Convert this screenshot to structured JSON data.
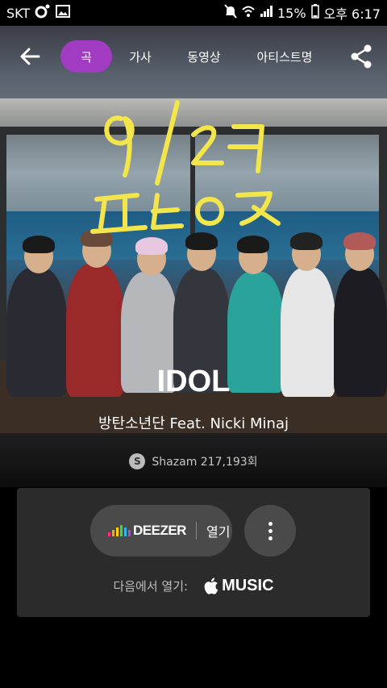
{
  "status_bar": {
    "carrier": "SKT",
    "battery": "15%",
    "time": "오후 6:17"
  },
  "nav": {
    "tabs": [
      {
        "label": "곡",
        "active": true
      },
      {
        "label": "가사",
        "active": false
      },
      {
        "label": "동영상",
        "active": false
      },
      {
        "label": "아티스트명",
        "active": false
      }
    ]
  },
  "song": {
    "title": "IDOL",
    "artist": "방탄소년단 Feat. Nicki Minaj",
    "shazam_count": "Shazam 217,193회"
  },
  "open_card": {
    "deezer_brand": "DEEZER",
    "open_label": "열기",
    "open_in_label": "다음에서 열기:",
    "apple_music_label": "MUSIC"
  },
  "colors": {
    "accent": "#a13bc2",
    "card_bg": "#2b2b2b",
    "button_bg": "#4a4a4a"
  }
}
